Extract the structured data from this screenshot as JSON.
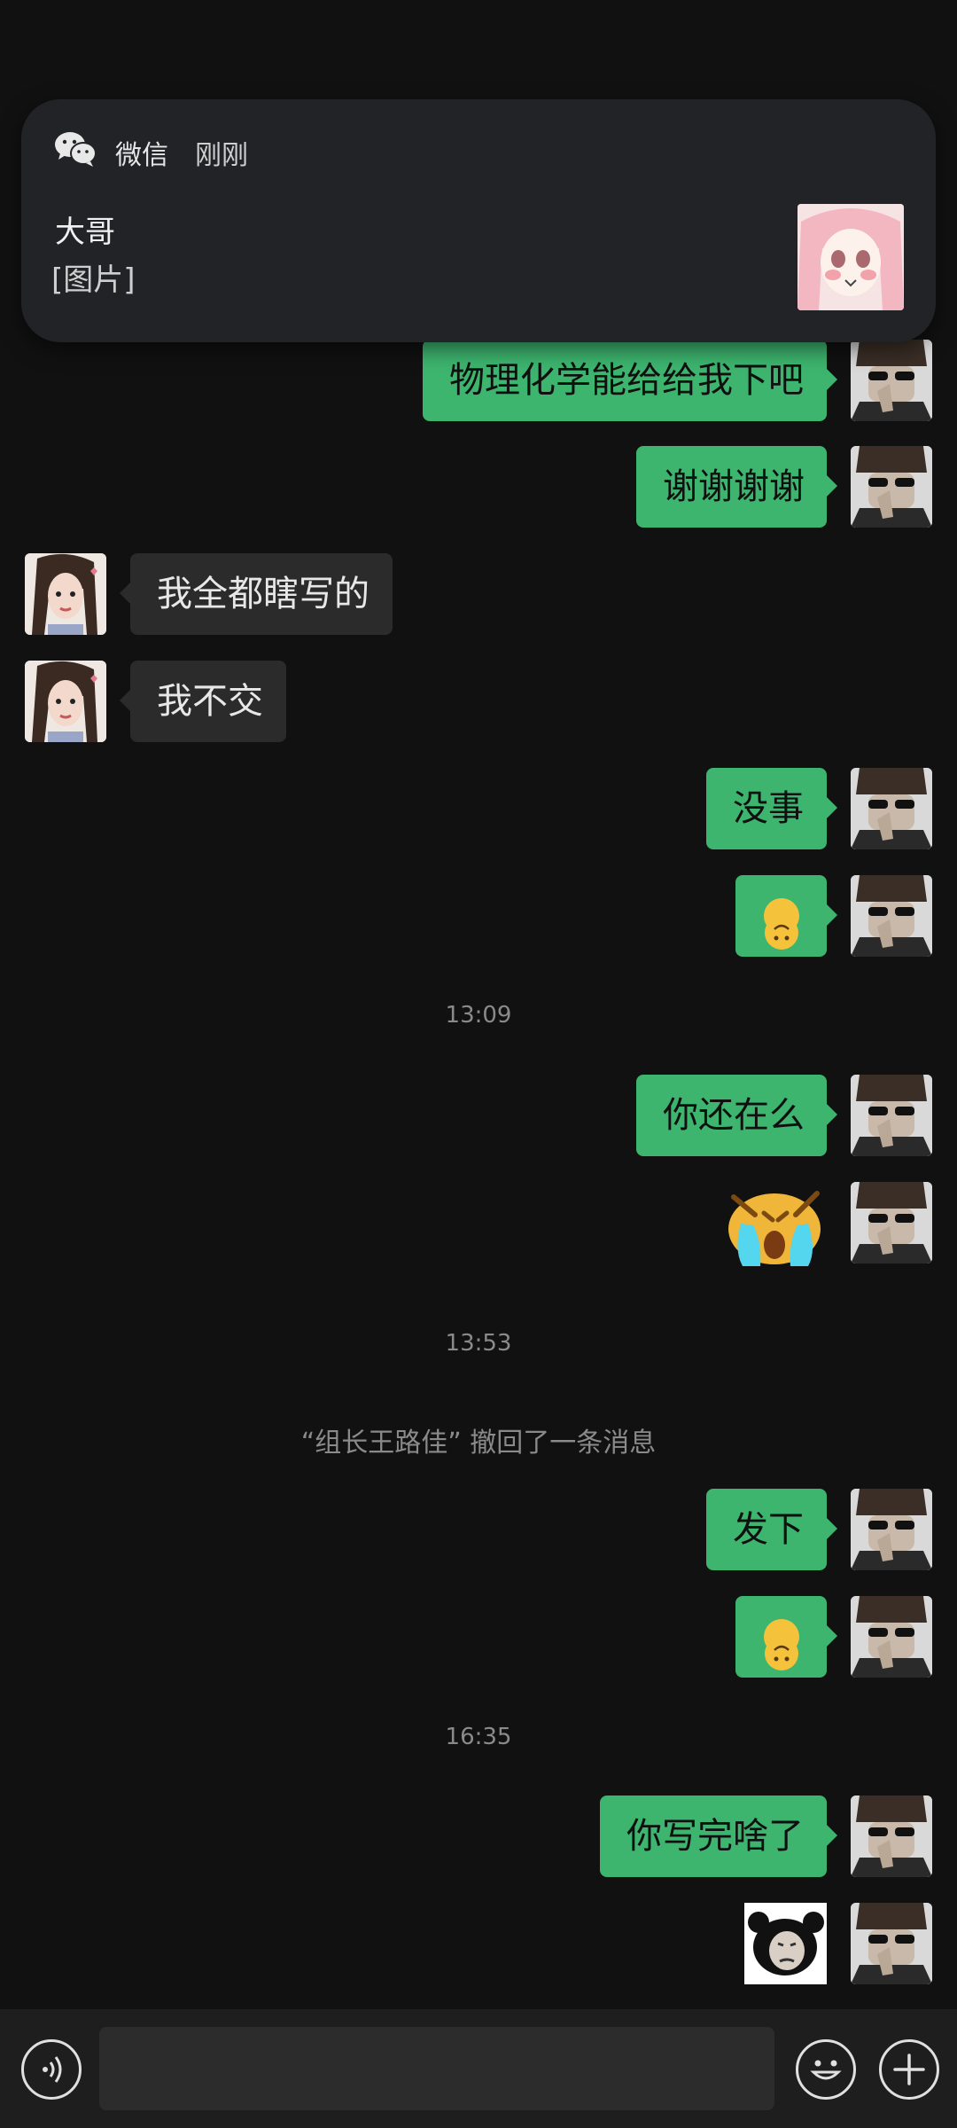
{
  "notification": {
    "app_name": "微信",
    "time": "刚刚",
    "sender": "大哥",
    "preview": "[图片]",
    "app_icon": "wechat-icon",
    "thumbnail": "anime-girl-image"
  },
  "messages": [
    {
      "from": "me",
      "text": "物理化学能给给我下吧"
    },
    {
      "from": "me",
      "text": "谢谢谢谢"
    },
    {
      "from": "other",
      "text": "我全都瞎写的"
    },
    {
      "from": "other",
      "text": "我不交"
    },
    {
      "from": "me",
      "text": "没事"
    },
    {
      "from": "me",
      "emoji": "upside-down-face-emoji"
    },
    {
      "timestamp": "13:09"
    },
    {
      "from": "me",
      "text": "你还在么"
    },
    {
      "from": "me",
      "sticker": "crying-sticker"
    },
    {
      "timestamp": "13:53"
    },
    {
      "system": "“组长王路佳” 撤回了一条消息"
    },
    {
      "from": "me",
      "text": "发下"
    },
    {
      "from": "me",
      "emoji": "upside-down-face-emoji"
    },
    {
      "timestamp": "16:35"
    },
    {
      "from": "me",
      "text": "你写完啥了"
    },
    {
      "from": "me",
      "sticker": "panda-meme-sticker"
    }
  ],
  "input": {
    "value": "",
    "voice_icon": "voice-icon",
    "emoji_icon": "emoji-icon",
    "plus_icon": "plus-icon"
  },
  "colors": {
    "background": "#111111",
    "my_bubble": "#3db56f",
    "other_bubble": "#2b2b2b",
    "notification_bg": "#222326",
    "timestamp_text": "#8a8a8a"
  }
}
